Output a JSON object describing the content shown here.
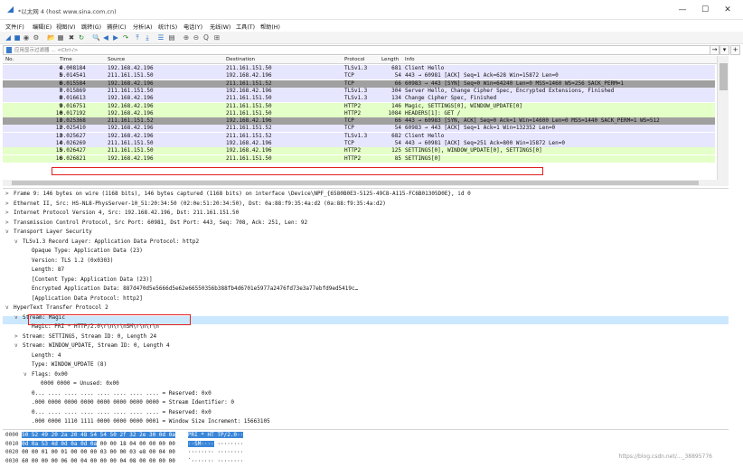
{
  "window": {
    "title": "*以太网 4 (host www.sina.com.cn)",
    "controls": [
      "—",
      "☐",
      "✕"
    ]
  },
  "menu": [
    "文件(F)",
    "编辑(E)",
    "视图(V)",
    "跳转(G)",
    "捕获(C)",
    "分析(A)",
    "统计(S)",
    "电话(Y)",
    "无线(W)",
    "工具(T)",
    "帮助(H)"
  ],
  "toolbar": {
    "icons": [
      "shark-fin-icon",
      "stop-icon",
      "restart-icon",
      "options-icon",
      "open-icon",
      "save-icon",
      "close-file-icon",
      "reload-icon",
      "find-icon",
      "back-icon",
      "forward-icon",
      "goto-icon",
      "first-icon",
      "last-icon",
      "autoscroll-icon",
      "colorize-icon",
      "zoom-in-icon",
      "zoom-out-icon",
      "zoom-normal-icon",
      "resize-columns-icon"
    ],
    "glyphs": [
      "◢",
      "■",
      "◉",
      "⚙",
      "📂",
      "▦",
      "✖",
      "↻",
      "🔍",
      "◀",
      "▶",
      "↷",
      "⤒",
      "⤓",
      "☰",
      "▤",
      "⊕",
      "⊖",
      "Q",
      "⊞"
    ]
  },
  "filter": {
    "placeholder": "应用显示过滤器 … <Ctrl-/>",
    "arrow": "→",
    "dropdown": "▾",
    "add": "+"
  },
  "packet_list": {
    "columns": [
      "No.",
      "Time",
      "Source",
      "Destination",
      "Protocol",
      "Length",
      "Info"
    ],
    "rows": [
      {
        "no": "4",
        "time": "0.008184",
        "src": "192.168.42.196",
        "dst": "211.161.151.50",
        "proto": "TLSv1.3",
        "len": "681",
        "info": "Client Hello",
        "bg": "#e7e6ff"
      },
      {
        "no": "5",
        "time": "0.014541",
        "src": "211.161.151.50",
        "dst": "192.168.42.196",
        "proto": "TCP",
        "len": "54",
        "info": "443 → 60981 [ACK] Seq=1 Ack=628 Win=15872 Len=0",
        "bg": "#e7e6ff"
      },
      {
        "no": "6",
        "time": "0.015584",
        "src": "192.168.42.196",
        "dst": "211.161.151.52",
        "proto": "TCP",
        "len": "66",
        "info": "60983 → 443 [SYN] Seq=0 Win=64240 Len=0 MSS=1460 WS=256 SACK_PERM=1",
        "bg": "#a0a0a0"
      },
      {
        "no": "7",
        "time": "0.015869",
        "src": "211.161.151.50",
        "dst": "192.168.42.196",
        "proto": "TLSv1.3",
        "len": "304",
        "info": "Server Hello, Change Cipher Spec, Encrypted Extensions, Finished",
        "bg": "#e7e6ff"
      },
      {
        "no": "8",
        "time": "0.016613",
        "src": "192.168.42.196",
        "dst": "211.161.151.50",
        "proto": "TLSv1.3",
        "len": "134",
        "info": "Change Cipher Spec, Finished",
        "bg": "#e7e6ff"
      },
      {
        "no": "9",
        "time": "0.016751",
        "src": "192.168.42.196",
        "dst": "211.161.151.50",
        "proto": "HTTP2",
        "len": "146",
        "info": "Magic, SETTINGS[0], WINDOW_UPDATE[0]",
        "bg": "#e4ffc7"
      },
      {
        "no": "10",
        "time": "0.017192",
        "src": "192.168.42.196",
        "dst": "211.161.151.50",
        "proto": "HTTP2",
        "len": "1084",
        "info": "HEADERS[1]: GET /",
        "bg": "#e4ffc7"
      },
      {
        "no": "11",
        "time": "0.025368",
        "src": "211.161.151.52",
        "dst": "192.168.42.196",
        "proto": "TCP",
        "len": "66",
        "info": "443 → 60983 [SYN, ACK] Seq=0 Ack=1 Win=14600 Len=0 MSS=1440 SACK_PERM=1 WS=512",
        "bg": "#a0a0a0"
      },
      {
        "no": "12",
        "time": "0.025410",
        "src": "192.168.42.196",
        "dst": "211.161.151.52",
        "proto": "TCP",
        "len": "54",
        "info": "60983 → 443 [ACK] Seq=1 Ack=1 Win=132352 Len=0",
        "bg": "#e7e6ff"
      },
      {
        "no": "13",
        "time": "0.025627",
        "src": "192.168.42.196",
        "dst": "211.161.151.52",
        "proto": "TLSv1.3",
        "len": "682",
        "info": "Client Hello",
        "bg": "#e7e6ff"
      },
      {
        "no": "14",
        "time": "0.026269",
        "src": "211.161.151.50",
        "dst": "192.168.42.196",
        "proto": "TCP",
        "len": "54",
        "info": "443 → 60981 [ACK] Seq=251 Ack=800 Win=15872 Len=0",
        "bg": "#e7e6ff"
      },
      {
        "no": "15",
        "time": "0.026427",
        "src": "211.161.151.50",
        "dst": "192.168.42.196",
        "proto": "HTTP2",
        "len": "125",
        "info": "SETTINGS[0], WINDOW_UPDATE[0], SETTINGS[0]",
        "bg": "#e4ffc7"
      },
      {
        "no": "16",
        "time": "0.026821",
        "src": "192.168.42.196",
        "dst": "211.161.151.50",
        "proto": "HTTP2",
        "len": "85",
        "info": "SETTINGS[0]",
        "bg": "#e4ffc7"
      }
    ]
  },
  "details": [
    {
      "indent": 0,
      "arrow": ">",
      "text": "Frame 9: 146 bytes on wire (1168 bits), 146 bytes captured (1168 bits) on interface \\Device\\NPF_{6580B0E3-5125-49C8-A115-FC6B01305D0E}, id 0"
    },
    {
      "indent": 0,
      "arrow": ">",
      "text": "Ethernet II, Src: HS-NL8-PhysServer-10_51:20:34:50 (02:0e:51:20:34:50), Dst: 0a:88:f9:35:4a:d2 (0a:88:f9:35:4a:d2)"
    },
    {
      "indent": 0,
      "arrow": ">",
      "text": "Internet Protocol Version 4, Src: 192.168.42.196, Dst: 211.161.151.50"
    },
    {
      "indent": 0,
      "arrow": ">",
      "text": "Transmission Control Protocol, Src Port: 60981, Dst Port: 443, Seq: 708, Ack: 251, Len: 92"
    },
    {
      "indent": 0,
      "arrow": "v",
      "text": "Transport Layer Security"
    },
    {
      "indent": 1,
      "arrow": "v",
      "text": "TLSv1.3 Record Layer: Application Data Protocol: http2"
    },
    {
      "indent": 2,
      "arrow": "",
      "text": "Opaque Type: Application Data (23)"
    },
    {
      "indent": 2,
      "arrow": "",
      "text": "Version: TLS 1.2 (0x0303)"
    },
    {
      "indent": 2,
      "arrow": "",
      "text": "Length: 87"
    },
    {
      "indent": 2,
      "arrow": "",
      "text": "[Content Type: Application Data (23)]"
    },
    {
      "indent": 2,
      "arrow": "",
      "text": "Encrypted Application Data: 887d470d5e5666d5e62e66550356b388fb4d6701e5977a2476fd73e3a77ebfd9ed5419c…"
    },
    {
      "indent": 2,
      "arrow": "",
      "text": "[Application Data Protocol: http2]"
    },
    {
      "indent": 0,
      "arrow": "v",
      "text": "HyperText Transfer Protocol 2"
    },
    {
      "indent": 1,
      "arrow": "v",
      "text": "Stream: Magic"
    },
    {
      "indent": 2,
      "arrow": "",
      "text": "Magic: PRI * HTTP/2.0\\r\\n\\r\\nSM\\r\\n\\r\\n"
    },
    {
      "indent": 1,
      "arrow": ">",
      "text": "Stream: SETTINGS, Stream ID: 0, Length 24"
    },
    {
      "indent": 1,
      "arrow": "v",
      "text": "Stream: WINDOW_UPDATE, Stream ID: 0, Length 4"
    },
    {
      "indent": 2,
      "arrow": "",
      "text": "Length: 4"
    },
    {
      "indent": 2,
      "arrow": "",
      "text": "Type: WINDOW_UPDATE (8)"
    },
    {
      "indent": 2,
      "arrow": "v",
      "text": "Flags: 0x00"
    },
    {
      "indent": 3,
      "arrow": "",
      "text": "0000 0000 = Unused: 0x00"
    },
    {
      "indent": 2,
      "arrow": "",
      "text": "0... .... .... .... .... .... .... .... = Reserved: 0x0"
    },
    {
      "indent": 2,
      "arrow": "",
      "text": ".000 0000 0000 0000 0000 0000 0000 0000 = Stream Identifier: 0"
    },
    {
      "indent": 2,
      "arrow": "",
      "text": "0... .... .... .... .... .... .... .... = Reserved: 0x0"
    },
    {
      "indent": 2,
      "arrow": "",
      "text": ".000 0000 1110 1111 0000 0000 0000 0001 = Window Size Increment: 15663105"
    }
  ],
  "bytes": [
    {
      "off": "0000",
      "hex_hl": "50 52 49 20 2a 20 48 54  54 50 2f 32 2e 30 0d 0a",
      "hex": "",
      "ascii_hl": "PRI * HT TP/2.0··",
      "ascii": ""
    },
    {
      "off": "0010",
      "hex_hl": "0d 0a 53 4d 0d 0a 0d 0a",
      "hex": "  00 00 18 04 00 00 00 00",
      "ascii_hl": "··SM····",
      "ascii": " ········"
    },
    {
      "off": "0020",
      "hex_hl": "",
      "hex": "00 00 01 00 01 00 00  00 03 00 00 03 e8 00 04 00",
      "ascii_hl": "",
      "ascii": "········ ········"
    },
    {
      "off": "0030",
      "hex_hl": "",
      "hex": "60 00 00 00 06 00 04  00 00 00 04 08 00 00 00 00",
      "ascii_hl": "",
      "ascii": "`······· ········"
    }
  ],
  "watermark": "https://blog.csdn.net/..._38895776"
}
